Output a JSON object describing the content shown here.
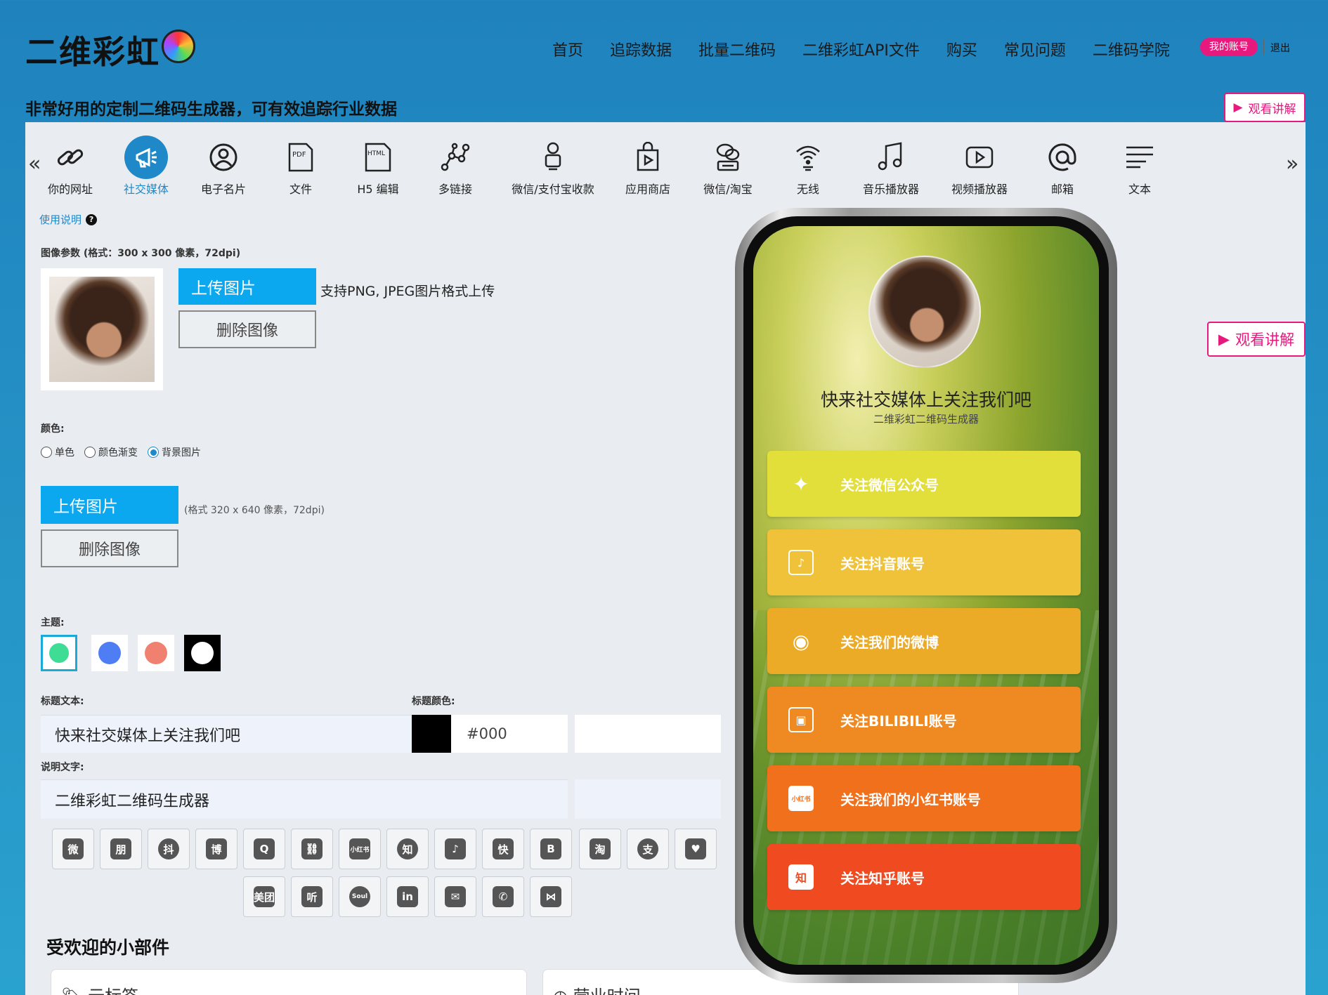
{
  "header": {
    "logo_text": "二维彩虹",
    "nav": [
      "首页",
      "追踪数据",
      "批量二维码",
      "二维彩虹API文件",
      "购买",
      "常见问题",
      "二维码学院"
    ],
    "account_label": "我的账号",
    "logout_label": "退出",
    "tagline": "非常好用的定制二维码生成器，可有效追踪行业数据",
    "watch_label": "观看讲解"
  },
  "toolbar": {
    "prev": "«",
    "next": "»",
    "items": [
      {
        "label": "你的网址",
        "icon": "link-icon"
      },
      {
        "label": "社交媒体",
        "icon": "megaphone-icon",
        "active": true
      },
      {
        "label": "电子名片",
        "icon": "user-icon"
      },
      {
        "label": "文件",
        "icon": "pdf-icon"
      },
      {
        "label": "H5 编辑",
        "icon": "html-icon"
      },
      {
        "label": "多链接",
        "icon": "network-icon"
      },
      {
        "label": "微信/支付宝收款",
        "icon": "payment-icon"
      },
      {
        "label": "应用商店",
        "icon": "app-store-icon"
      },
      {
        "label": "微信/淘宝",
        "icon": "wechat-taobao-icon"
      },
      {
        "label": "无线",
        "icon": "wifi-icon"
      },
      {
        "label": "音乐播放器",
        "icon": "music-icon"
      },
      {
        "label": "视频播放器",
        "icon": "video-icon"
      },
      {
        "label": "邮箱",
        "icon": "at-icon"
      },
      {
        "label": "文本",
        "icon": "text-icon"
      }
    ]
  },
  "editor": {
    "help_link": "使用说明",
    "image_params_label": "图像参数 (格式：300 x 300 像素，72dpi)",
    "upload_label": "上传图片",
    "delete_label": "删除图像",
    "upload_note": "支持PNG, JPEG图片格式上传",
    "color_label": "颜色:",
    "color_options": [
      "单色",
      "颜色渐变",
      "背景图片"
    ],
    "color_selected": "背景图片",
    "bg_upload_note": "(格式 320 x 640 像素，72dpi)",
    "theme_label": "主题:",
    "themes": [
      "#3fdc96",
      "#4f7df3",
      "#f08070",
      "#000000"
    ],
    "title_text_label": "标题文本:",
    "title_color_label": "标题颜色:",
    "title_value": "快来社交媒体上关注我们吧",
    "title_color_value": "#000",
    "desc_label": "说明文字:",
    "desc_value": "二维彩虹二维码生成器",
    "social_icons_row1": [
      "wechat-icon",
      "wechat-moments-icon",
      "douyin-round-icon",
      "weibo-icon",
      "qq-icon",
      "link-icon",
      "xiaohongshu-icon",
      "zhihu-icon",
      "tiktok-icon",
      "kuaishou-icon",
      "bilibili-icon",
      "taobao-icon",
      "alipay-icon",
      "heart-icon"
    ],
    "social_icons_row1_text": [
      "微",
      "朋",
      "抖",
      "博",
      "Q",
      "⛓",
      "小红书",
      "知",
      "♪",
      "快",
      "B",
      "淘",
      "支",
      "♥"
    ],
    "social_icons_row2": [
      "meituan-icon",
      "ting-icon",
      "soul-icon",
      "linkedin-icon",
      "mail-icon",
      "phone-icon",
      "butterfly-icon"
    ],
    "social_icons_row2_text": [
      "美团",
      "听",
      "Soul",
      "in",
      "✉",
      "✆",
      "⋈"
    ]
  },
  "widgets": {
    "title": "受欢迎的小部件",
    "cards": [
      "云标签",
      "营业时间"
    ]
  },
  "preview": {
    "title": "快来社交媒体上关注我们吧",
    "subtitle": "二维彩虹二维码生成器",
    "buttons": [
      {
        "label": "关注微信公众号",
        "color": "#e2de3a",
        "icon": "wechat-icon",
        "glyph": "✦"
      },
      {
        "label": "关注抖音账号",
        "color": "#efc23a",
        "icon": "tiktok-icon",
        "glyph": "♪"
      },
      {
        "label": "关注我们的微博",
        "color": "#ebab26",
        "icon": "weibo-icon",
        "glyph": "◉"
      },
      {
        "label": "关注BILIBILI账号",
        "color": "#ef8a23",
        "icon": "bilibili-icon",
        "glyph": "▣"
      },
      {
        "label": "关注我们的小红书账号",
        "color": "#f1701b",
        "icon": "xiaohongshu-icon",
        "glyph": "小红书"
      },
      {
        "label": "关注知乎账号",
        "color": "#ef4a20",
        "icon": "zhihu-icon",
        "glyph": "知"
      }
    ]
  }
}
